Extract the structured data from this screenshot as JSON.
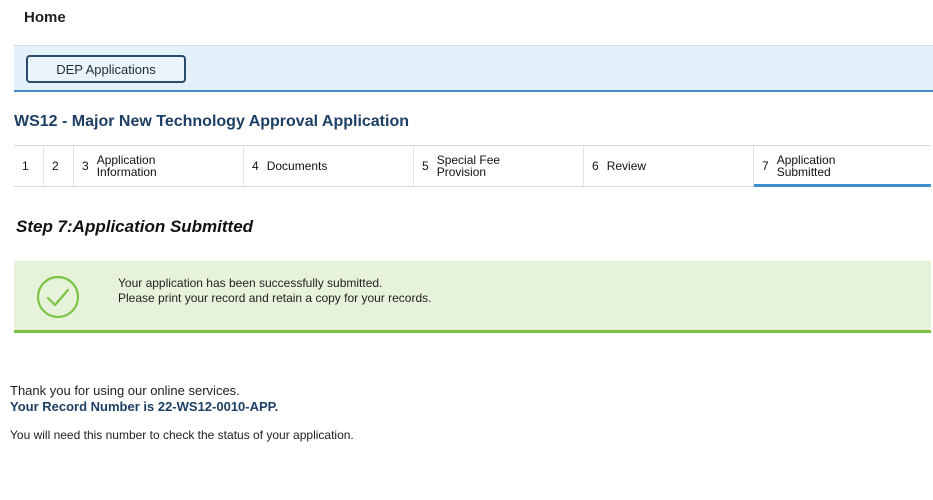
{
  "header": {
    "home_label": "Home"
  },
  "toolbar": {
    "dep_applications_label": "DEP Applications"
  },
  "application": {
    "title": "WS12 - Major New Technology Approval Application"
  },
  "steps": [
    {
      "num": "1",
      "label": ""
    },
    {
      "num": "2",
      "label": ""
    },
    {
      "num": "3",
      "label": "Application\nInformation"
    },
    {
      "num": "4",
      "label": "Documents"
    },
    {
      "num": "5",
      "label": "Special Fee\nProvision"
    },
    {
      "num": "6",
      "label": "Review"
    },
    {
      "num": "7",
      "label": "Application\nSubmitted",
      "current": true
    }
  ],
  "step_heading": "Step 7:Application Submitted",
  "success": {
    "icon": "check-circle-icon",
    "line1": "Your application has been successfully submitted.",
    "line2": "Please print your record and retain a copy for your records.",
    "accent_color": "#7cc242"
  },
  "thanks": {
    "line1": "Thank you for using our online services.",
    "record_line": "Your Record Number is 22-WS12-0010-APP."
  },
  "status_note": "You will need this number to check the status of your application."
}
